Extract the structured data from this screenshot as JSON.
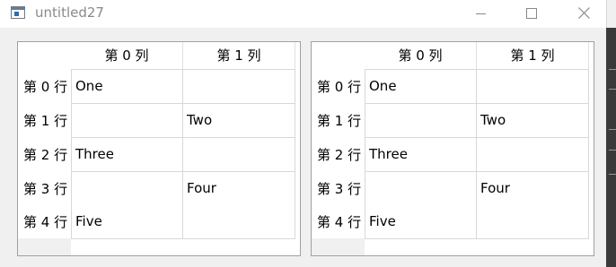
{
  "window": {
    "title": "untitled27"
  },
  "tables": [
    {
      "columns": [
        "第 0 列",
        "第 1 列"
      ],
      "rows": [
        {
          "header": "第 0 行",
          "cells": [
            "One",
            ""
          ]
        },
        {
          "header": "第 1 行",
          "cells": [
            "",
            "Two"
          ]
        },
        {
          "header": "第 2 行",
          "cells": [
            "Three",
            ""
          ]
        },
        {
          "header": "第 3 行",
          "cells": [
            "",
            "Four"
          ]
        },
        {
          "header": "第 4 行",
          "cells": [
            "Five",
            ""
          ]
        }
      ]
    },
    {
      "columns": [
        "第 0 列",
        "第 1 列"
      ],
      "rows": [
        {
          "header": "第 0 行",
          "cells": [
            "One",
            ""
          ]
        },
        {
          "header": "第 1 行",
          "cells": [
            "",
            "Two"
          ]
        },
        {
          "header": "第 2 行",
          "cells": [
            "Three",
            ""
          ]
        },
        {
          "header": "第 3 行",
          "cells": [
            "",
            "Four"
          ]
        },
        {
          "header": "第 4 行",
          "cells": [
            "Five",
            ""
          ]
        }
      ]
    }
  ]
}
